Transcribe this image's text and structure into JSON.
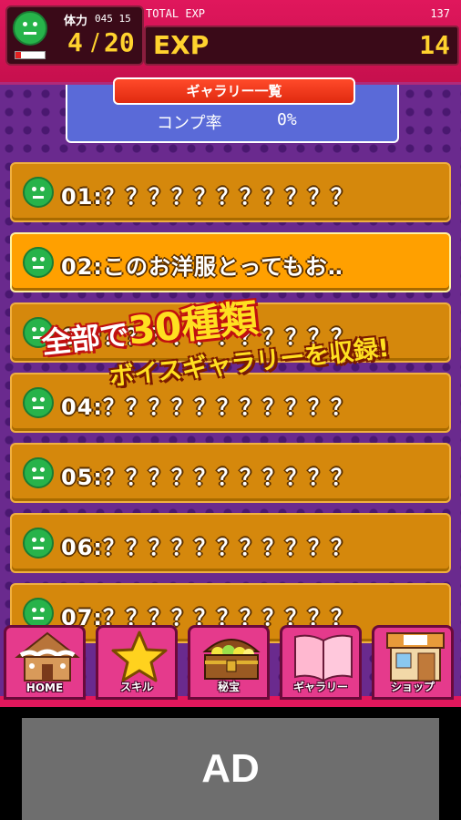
{
  "header": {
    "stamina_label": "体力",
    "stamina_timer": "045 15",
    "stamina_current": "4",
    "stamina_separator": "/",
    "stamina_max": "20",
    "stamina_fill_fraction": 0.2,
    "total_exp_label": "TOTAL EXP",
    "total_exp_value": "137",
    "exp_label": "EXP",
    "exp_value": "14"
  },
  "gallery": {
    "title": "ギャラリー一覧",
    "completion_label": "コンプ率",
    "completion_value": "0%"
  },
  "items": [
    {
      "text": "01:？？？？？？？？？？？",
      "highlighted": false
    },
    {
      "text": "02:このお洋服とってもお‥",
      "highlighted": true
    },
    {
      "text": "03:？？？？？？？？？？？",
      "highlighted": false
    },
    {
      "text": "04:？？？？？？？？？？？",
      "highlighted": false
    },
    {
      "text": "05:？？？？？？？？？？？",
      "highlighted": false
    },
    {
      "text": "06:？？？？？？？？？？？",
      "highlighted": false
    },
    {
      "text": "07:？？？？？？？？？？？",
      "highlighted": false
    }
  ],
  "promo": {
    "line1_prefix": "全部で",
    "line1_number": "30種類",
    "line2": "ボイスギャラリーを収録!"
  },
  "nav": [
    {
      "label": "HOME",
      "icon": "house-icon"
    },
    {
      "label": "スキル",
      "icon": "star-icon"
    },
    {
      "label": "秘宝",
      "icon": "treasure-chest-icon"
    },
    {
      "label": "ギャラリー",
      "icon": "book-icon"
    },
    {
      "label": "ショップ",
      "icon": "shop-icon"
    }
  ],
  "ad": {
    "text": "AD"
  },
  "colors": {
    "header": "#e0175c",
    "content_bg": "#6a2a8e",
    "item_bg": "#d5880c",
    "item_highlight": "#ffa000",
    "accent_yellow": "#ffd22e",
    "face_green": "#27b34a"
  }
}
